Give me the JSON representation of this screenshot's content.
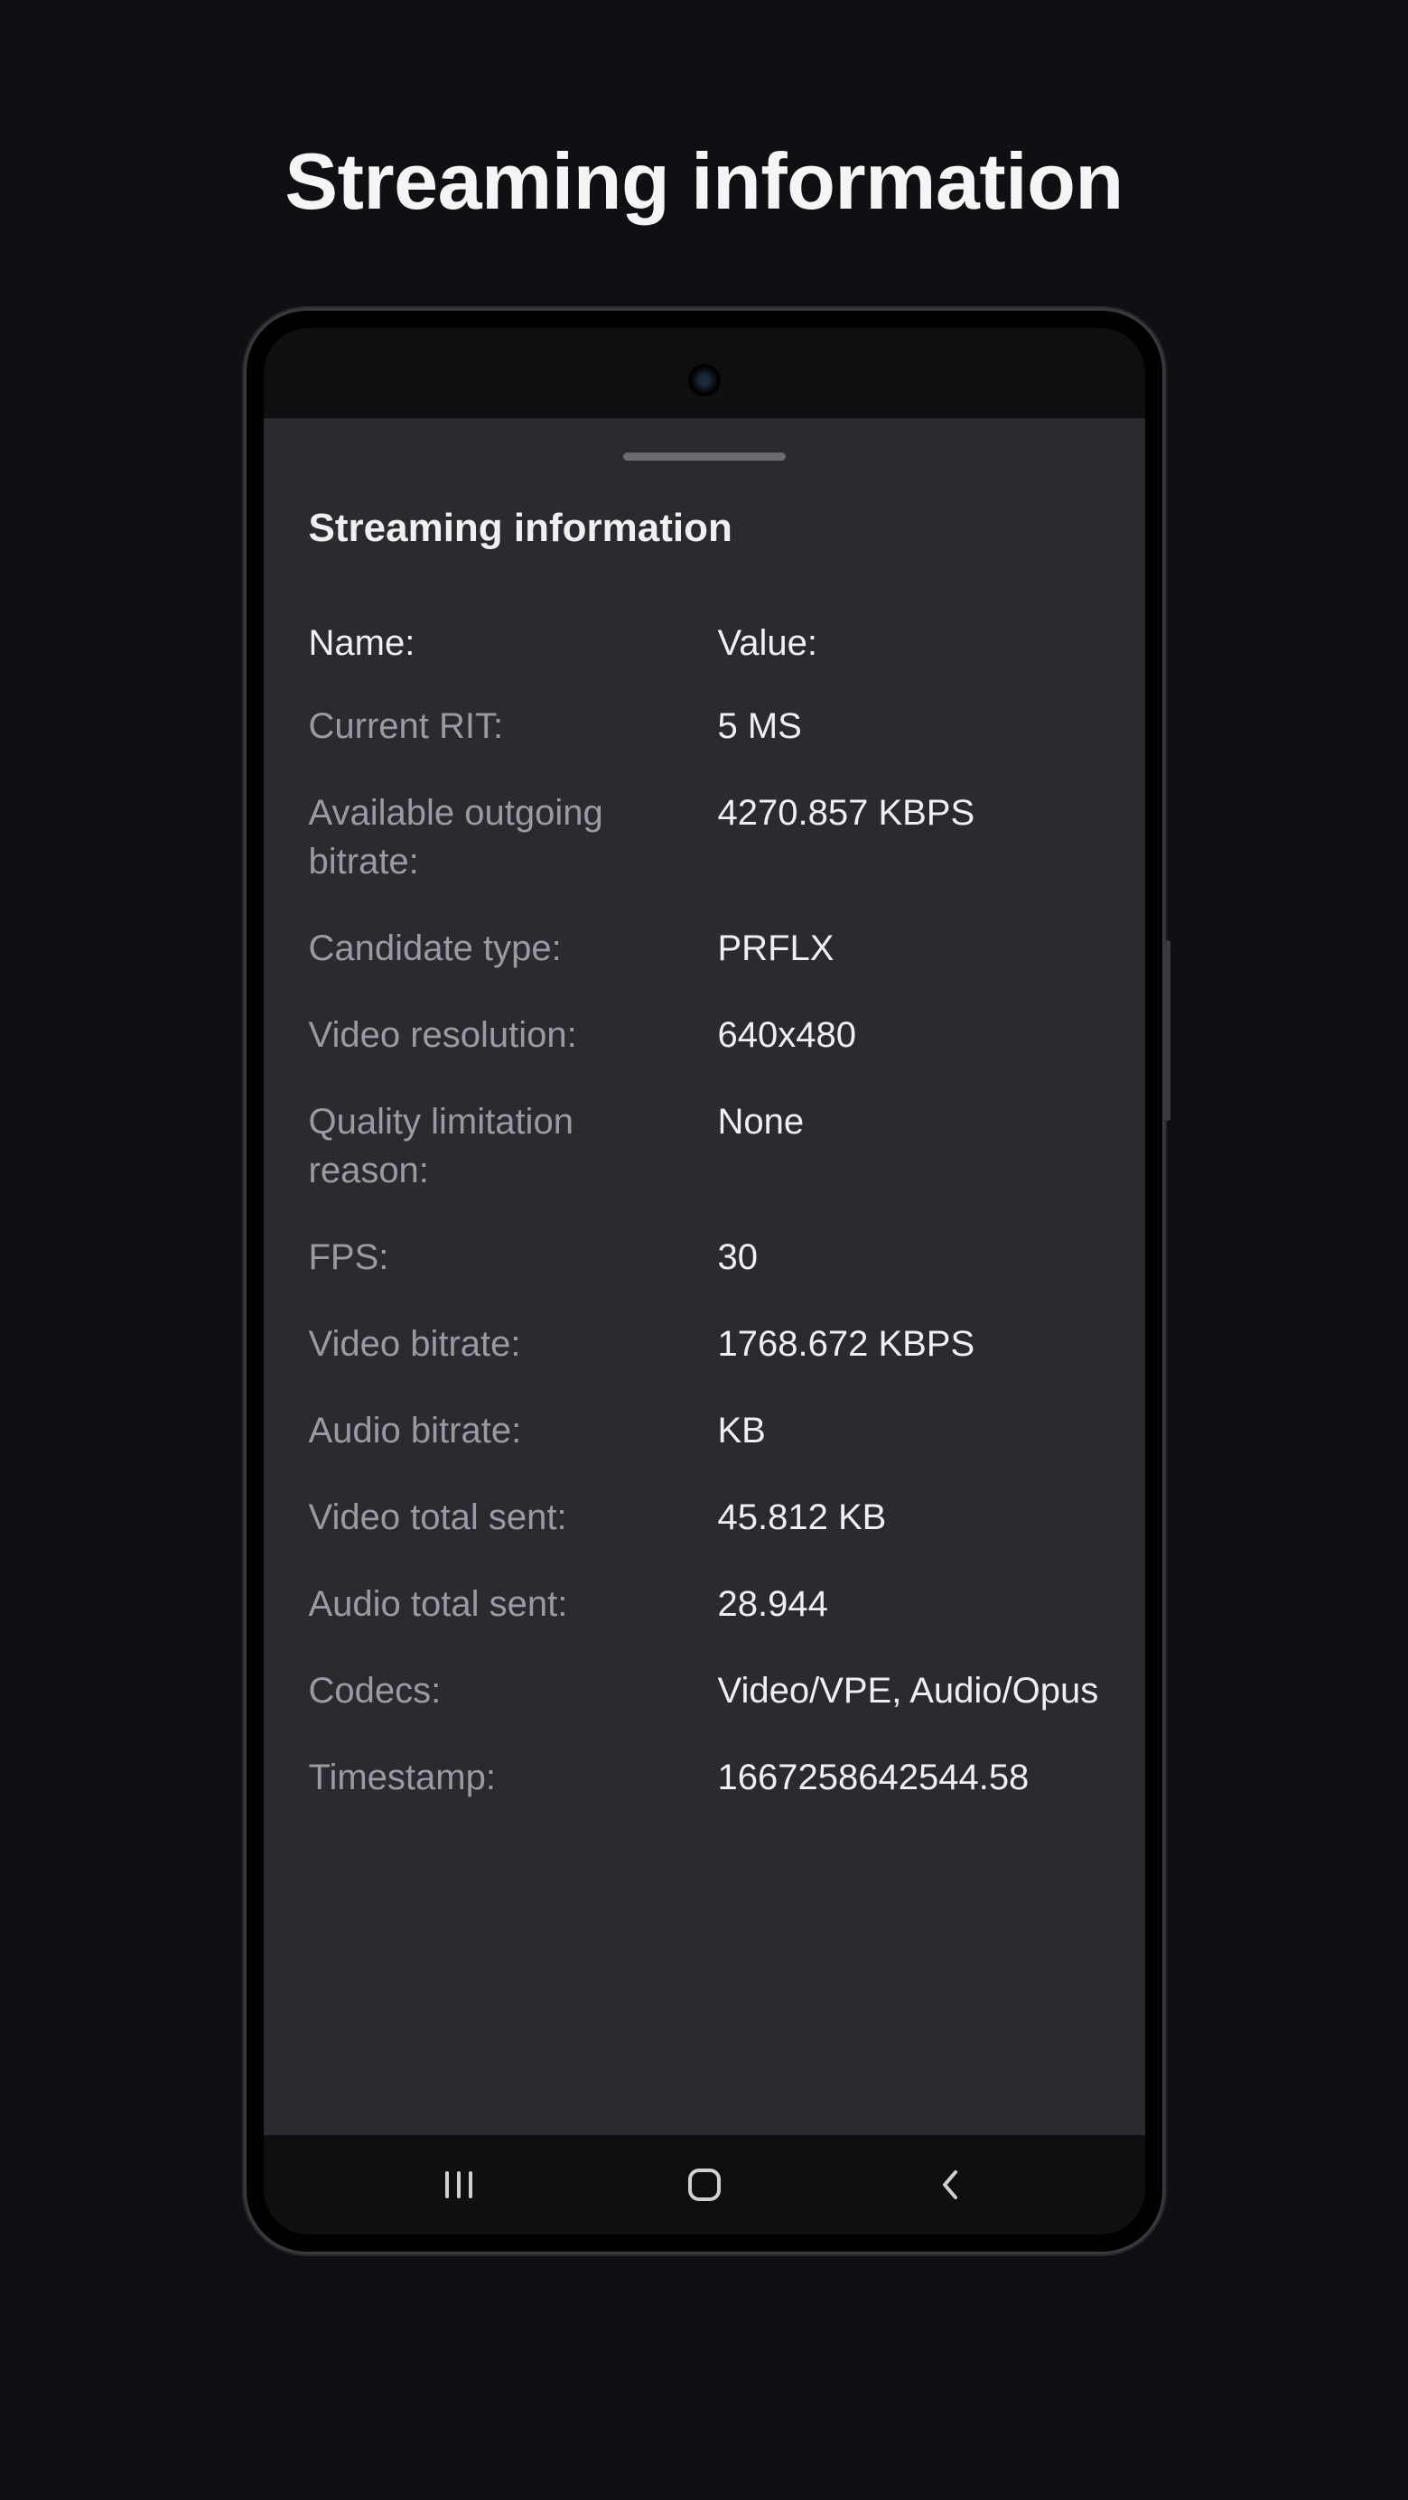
{
  "page": {
    "title": "Streaming information"
  },
  "sheet": {
    "title": "Streaming information",
    "header": {
      "name": "Name:",
      "value": "Value:"
    },
    "rows": [
      {
        "label": "Current RIT:",
        "value": "5 MS"
      },
      {
        "label": "Available outgoing bitrate:",
        "value": "4270.857 KBPS"
      },
      {
        "label": "Candidate type:",
        "value": "PRFLX"
      },
      {
        "label": "Video resolution:",
        "value": "640x480"
      },
      {
        "label": "Quality limitation reason:",
        "value": "None"
      },
      {
        "label": "FPS:",
        "value": "30"
      },
      {
        "label": "Video bitrate:",
        "value": "1768.672 KBPS"
      },
      {
        "label": "Audio bitrate:",
        "value": "KB"
      },
      {
        "label": "Video total sent:",
        "value": "45.812 KB"
      },
      {
        "label": "Audio total sent:",
        "value": "28.944"
      },
      {
        "label": "Codecs:",
        "value": "Video/VPE, Audio/Opus"
      },
      {
        "label": "Timestamp:",
        "value": "1667258642544.58"
      }
    ]
  }
}
